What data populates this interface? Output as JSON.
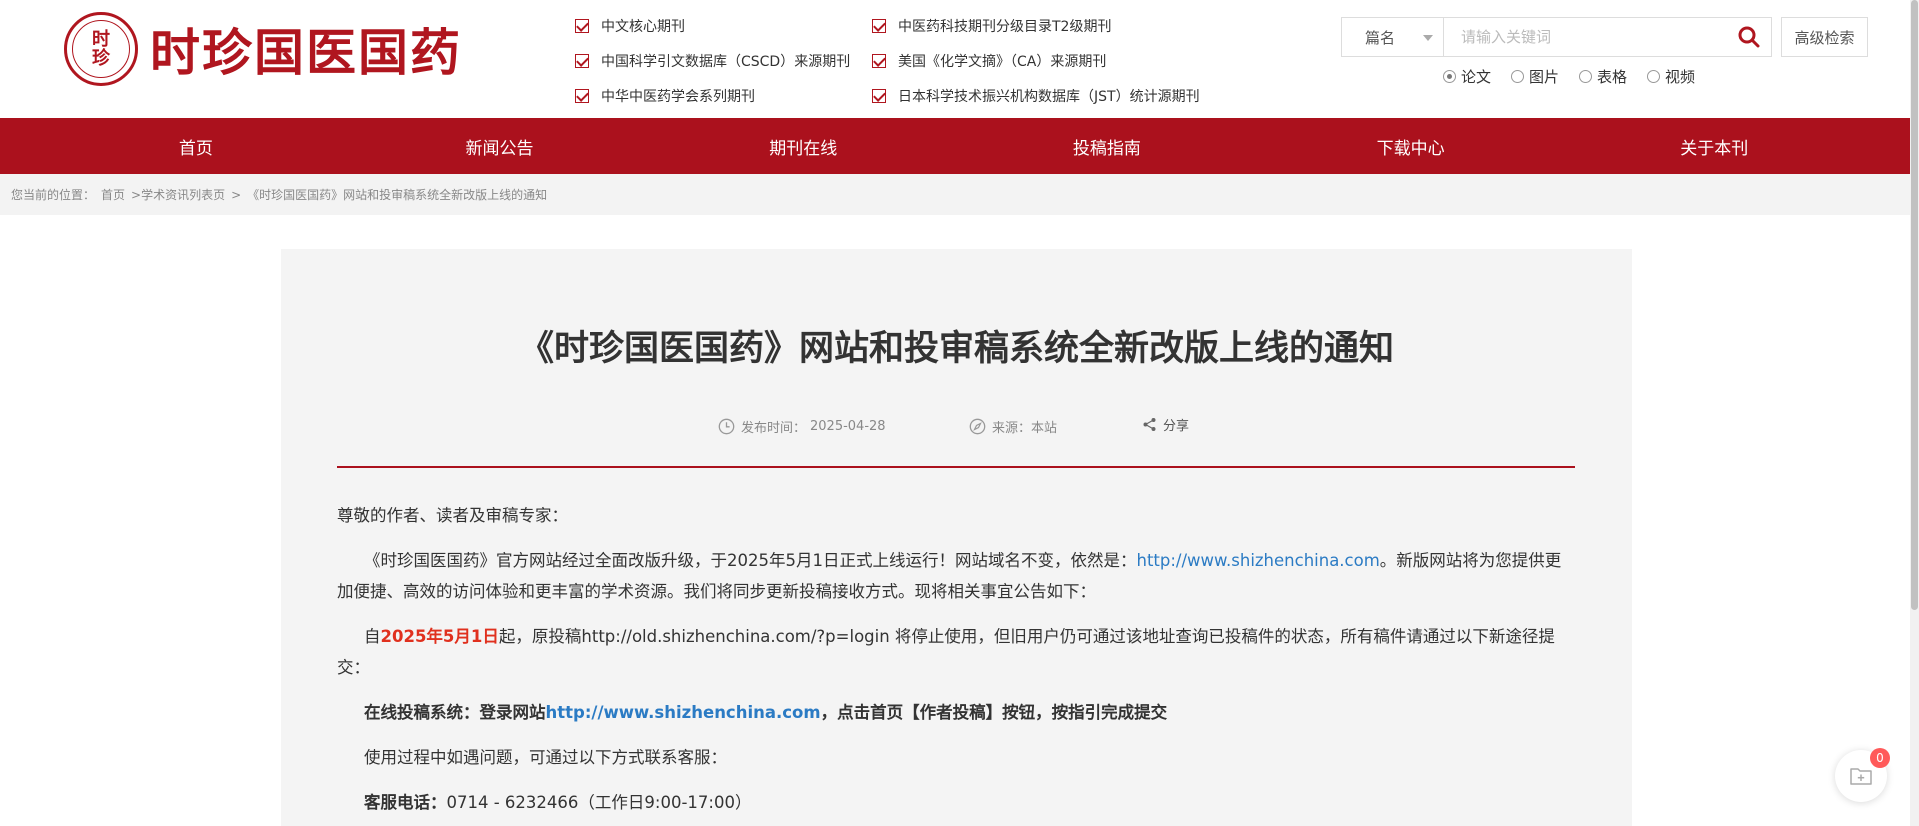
{
  "logo": {
    "seal_text": "时珍",
    "name": "时珍国医国药"
  },
  "categories_left": [
    "中文核心期刊",
    "中国科学引文数据库（CSCD）来源期刊",
    "中华中医药学会系列期刊"
  ],
  "categories_right": [
    "中医药科技期刊分级目录T2级期刊",
    "美国《化学文摘》（CA）来源期刊",
    "日本科学技术振兴机构数据库（JST）统计源期刊"
  ],
  "search": {
    "type_selected": "篇名",
    "placeholder": "请输入关键词",
    "advanced_label": "高级检索",
    "radios": [
      "论文",
      "图片",
      "表格",
      "视频"
    ]
  },
  "nav": [
    "首页",
    "新闻公告",
    "期刊在线",
    "投稿指南",
    "下载中心",
    "关于本刊"
  ],
  "breadcrumb": {
    "label": "您当前的位置：",
    "home": "首页",
    "list": ">学术资讯列表页",
    "sep": ">",
    "current": "《时珍国医国药》网站和投审稿系统全新改版上线的通知"
  },
  "article": {
    "title": "《时珍国医国药》网站和投审稿系统全新改版上线的通知",
    "publish_label": "发布时间：",
    "publish_date": "2025-04-28",
    "source_label": "来源：",
    "source_value": "本站",
    "share_label": "分享",
    "greeting": "尊敬的作者、读者及审稿专家：",
    "p1_a": "《时珍国医国药》官方网站经过全面改版升级，于2025年5月1日正式上线运行！网站域名不变，依然是：",
    "p1_link": "http://www.shizhenchina.com",
    "p1_b": "。新版网站将为您提供更加便捷、高效的访问体验和更丰富的学术资源。我们将同步更新投稿接收方式。现将相关事宜公告如下：",
    "p2_a": "自",
    "p2_date": "2025年5月1日",
    "p2_b": "起，原投稿http://old.shizhenchina.com/?p=login 将停止使用，但旧用户仍可通过该地址查询已投稿件的状态，所有稿件请通过以下新途径提交：",
    "p3_a": "在线投稿系统：登录网站",
    "p3_link": "http://www.shizhenchina.com",
    "p3_b": "，点击首页【作者投稿】按钮，按指引完成提交",
    "p4": "使用过程中如遇问题，可通过以下方式联系客服：",
    "p5_label": "客服电话：",
    "p5_value": "0714 - 6232466（工作日9:00-17:00）"
  },
  "float_badge": "0",
  "colors": {
    "brand_red": "#ab111d",
    "link_blue": "#2b7bc4",
    "highlight_red": "#e0301e"
  }
}
